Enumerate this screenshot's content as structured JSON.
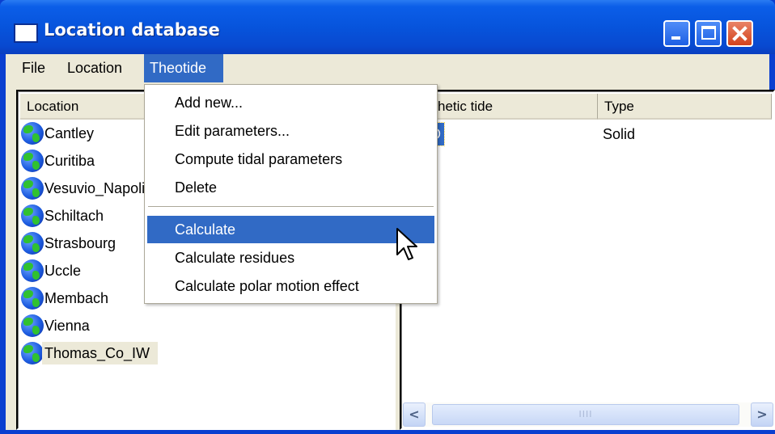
{
  "window": {
    "title": "Location database"
  },
  "menubar": {
    "file": "File",
    "location": "Location",
    "theotide": "Theotide"
  },
  "locations": {
    "header": "Location",
    "items": [
      "Cantley",
      "Curitiba",
      "Vesuvio_Napoli",
      "Schiltach",
      "Strasbourg",
      "Uccle",
      "Membach",
      "Vienna",
      "Thomas_Co_IW"
    ],
    "selected": "Thomas_Co_IW"
  },
  "tides": {
    "headers": {
      "name": "Synthetic tide",
      "type": "Type"
    },
    "rows": [
      {
        "name": "WDD",
        "type": "Solid"
      }
    ]
  },
  "theotide_menu": {
    "items": [
      "Add new...",
      "Edit parameters...",
      "Compute tidal parameters",
      "Delete",
      "Calculate",
      "Calculate residues",
      "Calculate polar motion effect"
    ],
    "highlighted": "Calculate"
  },
  "scrollbar": {
    "left_arrow": "<",
    "right_arrow": ">",
    "grip": "IIII"
  },
  "colors": {
    "titlebar": "#0754dc",
    "highlight": "#316ac5",
    "chrome": "#ece9d8",
    "close_button": "#d3431c"
  },
  "icons": {
    "location_item": "globe-icon",
    "app": "window-icon"
  }
}
